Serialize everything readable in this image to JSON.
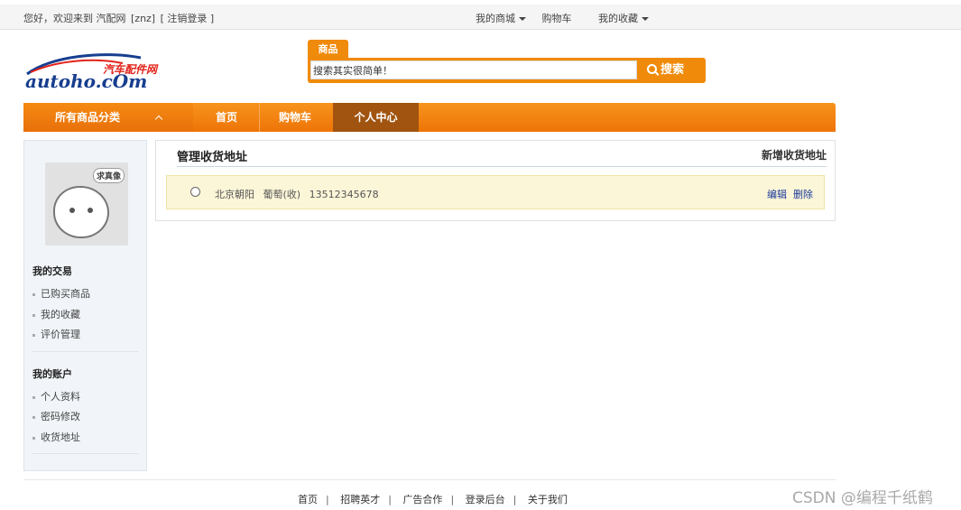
{
  "topbar": {
    "welcome": "您好，欢迎来到 汽配网",
    "username": "[znz]",
    "logout": "[ 注销登录 ]",
    "my_mall": "我的商城",
    "cart": "购物车",
    "favorites": "我的收藏"
  },
  "logo": {
    "cn": "汽车配件网",
    "en": "autoho.cOm"
  },
  "search": {
    "tab": "商品",
    "value": "搜索其实很简单！",
    "button": "搜索"
  },
  "nav": {
    "categories": "所有商品分类",
    "home": "首页",
    "cart": "购物车",
    "user_center": "个人中心"
  },
  "sidebar": {
    "avatar_tag": "求真像",
    "trade_title": "我的交易",
    "trade_items": [
      "已购买商品",
      "我的收藏",
      "评价管理"
    ],
    "account_title": "我的账户",
    "account_items": [
      "个人资料",
      "密码修改",
      "收货地址"
    ]
  },
  "main": {
    "title": "管理收货地址",
    "add": "新增收货地址",
    "address": {
      "region": "北京朝阳",
      "name": "葡萄(收)",
      "phone": "13512345678",
      "edit": "编辑",
      "delete": "删除"
    }
  },
  "footer": {
    "links": [
      "首页",
      "招聘英才",
      "广告合作",
      "登录后台",
      "关于我们"
    ]
  },
  "watermark": "CSDN @编程千纸鹤"
}
